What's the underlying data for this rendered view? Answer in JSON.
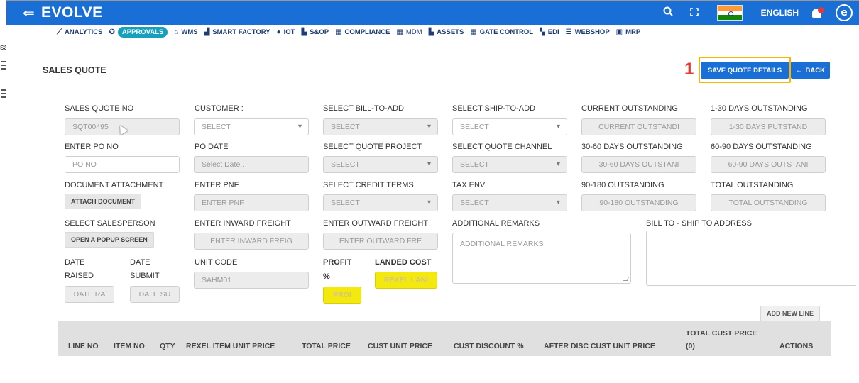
{
  "app": {
    "brand": "EVOLVE",
    "language": "ENGLISH"
  },
  "left_rail": {
    "module_label": "sales"
  },
  "modules": [
    {
      "label": "ANALYTICS",
      "icon": "chart-line-icon",
      "active": false
    },
    {
      "label": "APPROVALS",
      "icon": "gear-check-icon",
      "active": true
    },
    {
      "label": "WMS",
      "icon": "warehouse-icon",
      "active": false
    },
    {
      "label": "SMART FACTORY",
      "icon": "bar-chart-icon",
      "active": false
    },
    {
      "label": "IOT",
      "icon": "dot-icon",
      "active": false
    },
    {
      "label": "S&OP",
      "icon": "document-icon",
      "active": false
    },
    {
      "label": "COMPLIANCE",
      "icon": "calculator-icon",
      "active": false
    },
    {
      "label": "MDM",
      "icon": "calculator-icon",
      "active": false
    },
    {
      "label": "ASSETS",
      "icon": "document-icon",
      "active": false
    },
    {
      "label": "GATE CONTROL",
      "icon": "calculator-icon",
      "active": false
    },
    {
      "label": "EDI",
      "icon": "grid-icon",
      "active": false
    },
    {
      "label": "WEBSHOP",
      "icon": "list-icon",
      "active": false
    },
    {
      "label": "MRP",
      "icon": "monitor-icon",
      "active": false
    }
  ],
  "page": {
    "title": "SALES QUOTE",
    "callout": "1",
    "save_label": "SAVE QUOTE DETAILS",
    "back_label": "BACK"
  },
  "form": {
    "sales_quote_no": {
      "label": "SALES QUOTE NO",
      "value": "SQT00495"
    },
    "customer": {
      "label": "CUSTOMER :",
      "value": "SELECT"
    },
    "bill_to": {
      "label": "SELECT BILL-TO-ADD",
      "value": "SELECT"
    },
    "ship_to": {
      "label": "SELECT SHIP-TO-ADD",
      "value": "SELECT"
    },
    "current_outstanding": {
      "label": "CURRENT OUTSTANDING",
      "placeholder": "CURRENT OUTSTANDI"
    },
    "days_1_30": {
      "label": "1-30 DAYS OUTSTANDING",
      "placeholder": "1-30 DAYS PUTSTAND"
    },
    "po_no": {
      "label": "ENTER PO NO",
      "placeholder": "PO NO"
    },
    "po_date": {
      "label": "PO DATE",
      "placeholder": "Select Date.."
    },
    "quote_project": {
      "label": "SELECT QUOTE PROJECT",
      "value": "SELECT"
    },
    "quote_channel": {
      "label": "SELECT QUOTE CHANNEL",
      "value": "SELECT"
    },
    "days_30_60": {
      "label": "30-60 DAYS OUTSTANDING",
      "placeholder": "30-60 DAYS OUTSTANI"
    },
    "days_60_90": {
      "label": "60-90 DAYS OUTSTANDING",
      "placeholder": "60-90 DAYS OUTSTANI"
    },
    "document_attachment": {
      "label": "DOCUMENT ATTACHMENT",
      "button": "ATTACH DOCUMENT"
    },
    "pnf": {
      "label": "ENTER PNF",
      "placeholder": "ENTER PNF"
    },
    "credit_terms": {
      "label": "SELECT CREDIT TERMS",
      "value": "SELECT"
    },
    "tax_env": {
      "label": "TAX ENV",
      "value": "SELECT"
    },
    "days_90_180": {
      "label": "90-180 OUTSTANDING",
      "placeholder": "90-180 OUTSTANDING"
    },
    "total_outstanding": {
      "label": "TOTAL OUTSTANDING",
      "placeholder": "TOTAL OUTSTANDING"
    },
    "salesperson": {
      "label": "SELECT SALESPERSON",
      "button": "OPEN A POPUP SCREEN"
    },
    "inward_freight": {
      "label": "ENTER INWARD FREIGHT",
      "placeholder": "ENTER INWARD FREIG"
    },
    "outward_freight": {
      "label": "ENTER OUTWARD FREIGHT",
      "placeholder": "ENTER OUTWARD FRE"
    },
    "additional_remarks": {
      "label": "ADDITIONAL REMARKS",
      "placeholder": "ADDITIONAL REMARKS"
    },
    "bill_ship_address": {
      "label": "BILL TO - SHIP TO ADDRESS"
    },
    "date_raised": {
      "label_1": "DATE",
      "label_2": "RAISED",
      "placeholder": "DATE RA"
    },
    "date_submit": {
      "label_1": "DATE",
      "label_2": "SUBMIT",
      "placeholder": "DATE SU"
    },
    "unit_code": {
      "label": "UNIT CODE",
      "value": "SAHM01"
    },
    "profit": {
      "label_1": "PROFIT",
      "label_2": "%",
      "placeholder": "PROI"
    },
    "landed_cost": {
      "label": "LANDED COST",
      "placeholder": "REXEL LANI"
    },
    "add_new_line": "ADD NEW LINE"
  },
  "table": {
    "headers": [
      "LINE NO",
      "ITEM NO",
      "QTY",
      "REXEL ITEM UNIT PRICE",
      "TOTAL PRICE",
      "CUST UNIT PRICE",
      "CUST DISCOUNT %",
      "AFTER DISC CUST UNIT PRICE",
      "TOTAL CUST PRICE",
      "(0)",
      "ACTIONS"
    ]
  },
  "colors": {
    "primary": "#1a6fd6",
    "approvals_pill": "#17a0bc",
    "highlight": "#f4e90e",
    "callout": "#e53935",
    "callout_box": "#f5b800"
  }
}
